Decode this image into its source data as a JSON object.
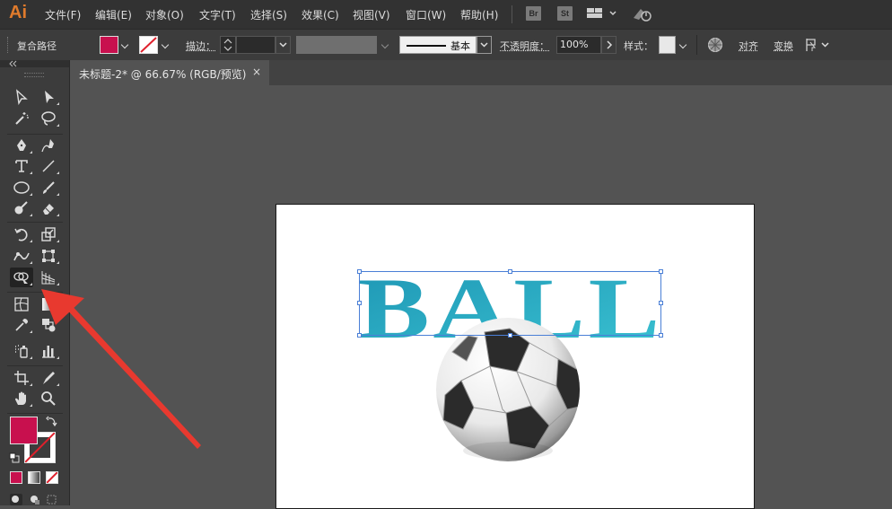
{
  "app": {
    "logo": "Ai"
  },
  "menu": [
    "文件(F)",
    "编辑(E)",
    "对象(O)",
    "文字(T)",
    "选择(S)",
    "效果(C)",
    "视图(V)",
    "窗口(W)",
    "帮助(H)"
  ],
  "app_buttons": {
    "bridge": "Br",
    "stock": "St"
  },
  "controlbar": {
    "selection_type": "复合路径",
    "stroke_label": "描边：",
    "profile_label": "基本",
    "opacity_label": "不透明度：",
    "opacity_value": "100%",
    "style_label": "样式：",
    "align_label": "对齐",
    "transform_label": "变换"
  },
  "document_tab": {
    "title": "未标题-2* @ 66.67% (RGB/预览)",
    "close": "×"
  },
  "canvas": {
    "text": "BALL"
  },
  "colors": {
    "fill": "#c8104e",
    "text_gradient_start": "#1e96b4",
    "text_gradient_end": "#3ac2d2",
    "selection": "#4a7fd6",
    "annotation_arrow": "#e8392f",
    "logo": "#e07b2c"
  },
  "icons": {
    "toolbar": [
      "selection-tool-icon",
      "direct-selection-tool-icon",
      "magic-wand-icon",
      "lasso-icon",
      "pen-tool-icon",
      "curvature-tool-icon",
      "type-tool-icon",
      "line-tool-icon",
      "ellipse-tool-icon",
      "paintbrush-icon",
      "shaper-tool-icon",
      "eraser-icon",
      "rotate-tool-icon",
      "scale-tool-icon",
      "width-tool-icon",
      "free-transform-icon",
      "shape-builder-icon",
      "perspective-grid-icon",
      "mesh-tool-icon",
      "gradient-tool-icon",
      "eyedropper-icon",
      "blend-tool-icon",
      "symbol-sprayer-icon",
      "column-graph-icon",
      "artboard-tool-icon",
      "slice-tool-icon",
      "hand-tool-icon",
      "zoom-tool-icon"
    ]
  }
}
